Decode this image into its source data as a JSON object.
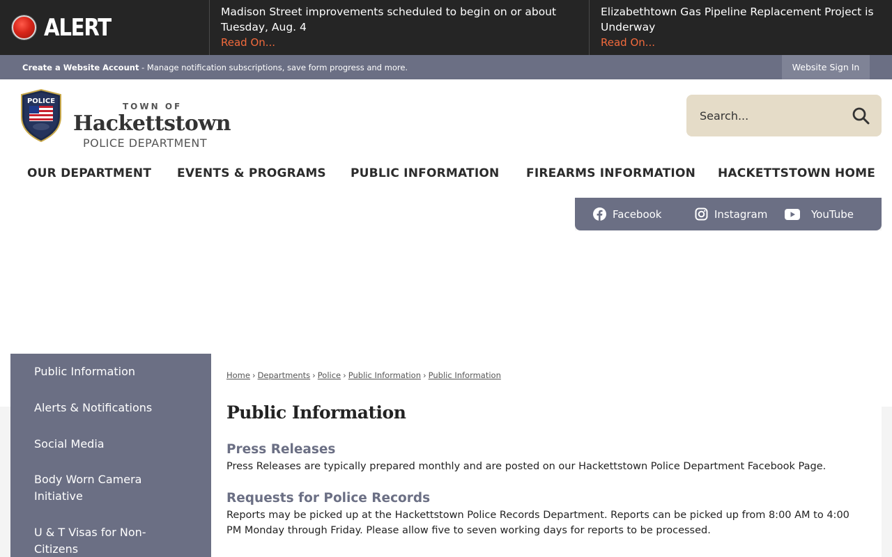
{
  "alert": {
    "label": "ALERT",
    "items": [
      {
        "message": "Madison Street improvements scheduled to begin on or about Tuesday, Aug. 4",
        "link": "Read On..."
      },
      {
        "message": "Elizabethtown Gas Pipeline Replacement Project is Underway",
        "link": "Read On..."
      }
    ]
  },
  "account": {
    "create_label": "Create a Website Account",
    "description": " - Manage notification subscriptions, save form progress and more.",
    "signin": "Website Sign In"
  },
  "logo": {
    "badge_text": "POLICE",
    "town_of": "TOWN OF",
    "name": "Hackettstown",
    "department": "POLICE DEPARTMENT"
  },
  "search": {
    "placeholder": "Search..."
  },
  "nav": [
    "OUR DEPARTMENT",
    "EVENTS & PROGRAMS",
    "PUBLIC INFORMATION",
    "FIREARMS INFORMATION",
    "HACKETTSTOWN HOME"
  ],
  "social": [
    "Facebook",
    "Instagram",
    "YouTube"
  ],
  "sidebar": [
    "Public Information",
    "Alerts & Notifications",
    "Social Media",
    "Body Worn Camera Initiative",
    "U & T Visas for Non-Citizens"
  ],
  "breadcrumb": [
    "Home",
    "Departments",
    "Police",
    "Public Information",
    "Public Information"
  ],
  "page_title": "Public Information",
  "sections": [
    {
      "title": "Press Releases",
      "text": "Press Releases are typically prepared monthly and are posted on our Hackettstown Police Department Facebook Page."
    },
    {
      "title": "Requests for Police Records",
      "text": "Reports may be picked up at the Hackettstown Police Records Department. Reports can be picked up from 8:00 AM to 4:00 PM Monday through Friday. Please allow five to seven working days for reports to be processed."
    }
  ],
  "colors": {
    "alert_bg": "#252525",
    "accent": "#6b6f84",
    "search_bg": "#e5dcc8",
    "alert_link": "#f26a3c"
  }
}
